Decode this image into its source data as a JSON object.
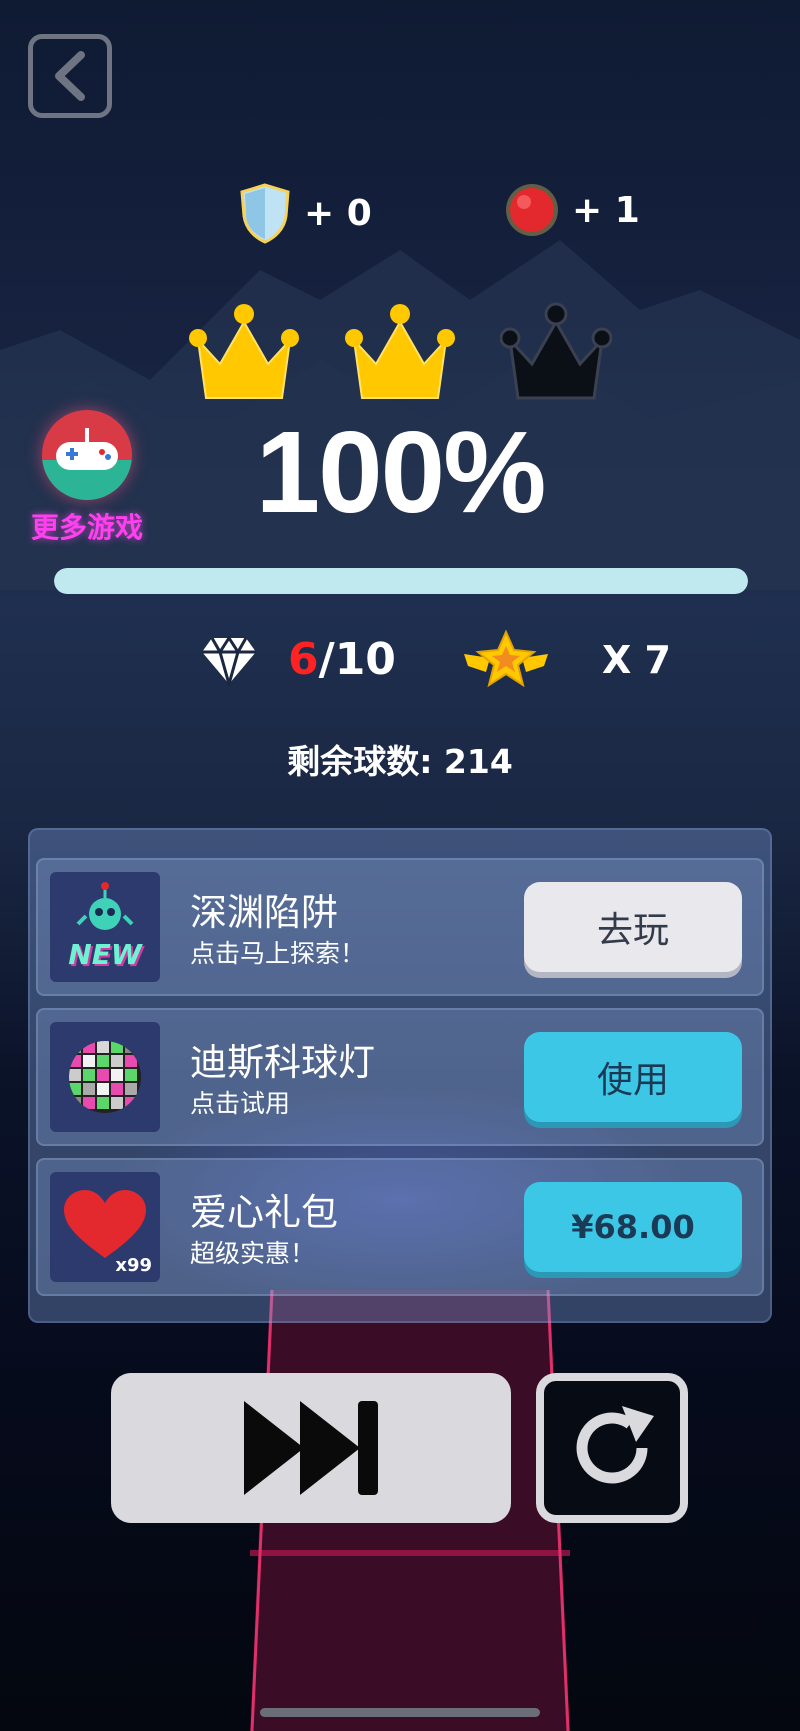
{
  "header": {
    "back_icon": "back-arrow-icon",
    "rewards": [
      {
        "icon": "shield-icon",
        "text": "+ 0",
        "color": "#bfe3f5"
      },
      {
        "icon": "red-ball-icon",
        "text": "+ 1",
        "color": "#e3282e"
      }
    ]
  },
  "crowns": {
    "earned": 2,
    "total": 3,
    "colors": {
      "earned": "#ffc800",
      "empty": "#0b0f16"
    }
  },
  "more_games": {
    "label": "更多游戏",
    "icon": "gamepad-icon"
  },
  "result": {
    "percent_text": "100%",
    "progress": 1.0
  },
  "stats": {
    "gems_collected": "6",
    "gems_total": "/10",
    "gem_icon": "diamond-icon",
    "star_icon": "winged-star-icon",
    "star_multiplier": "X 7"
  },
  "balls_left": {
    "label": "剩余球数:",
    "value": "214"
  },
  "offers": [
    {
      "title": "深渊陷阱",
      "subtitle": "点击马上探索！",
      "button": "去玩",
      "thumb_icon": "new-game-icon",
      "thumb_badge": "NEW",
      "style": "gray"
    },
    {
      "title": "迪斯科球灯",
      "subtitle": "点击试用",
      "button": "使用",
      "thumb_icon": "disco-ball-icon",
      "style": "cyan"
    },
    {
      "title": "爱心礼包",
      "subtitle": "超级实惠！",
      "button": "¥68.00",
      "thumb_icon": "heart-icon",
      "thumb_badge": "x99",
      "style": "cyan"
    }
  ],
  "controls": {
    "skip_icon": "skip-forward-icon",
    "retry_icon": "retry-icon"
  }
}
